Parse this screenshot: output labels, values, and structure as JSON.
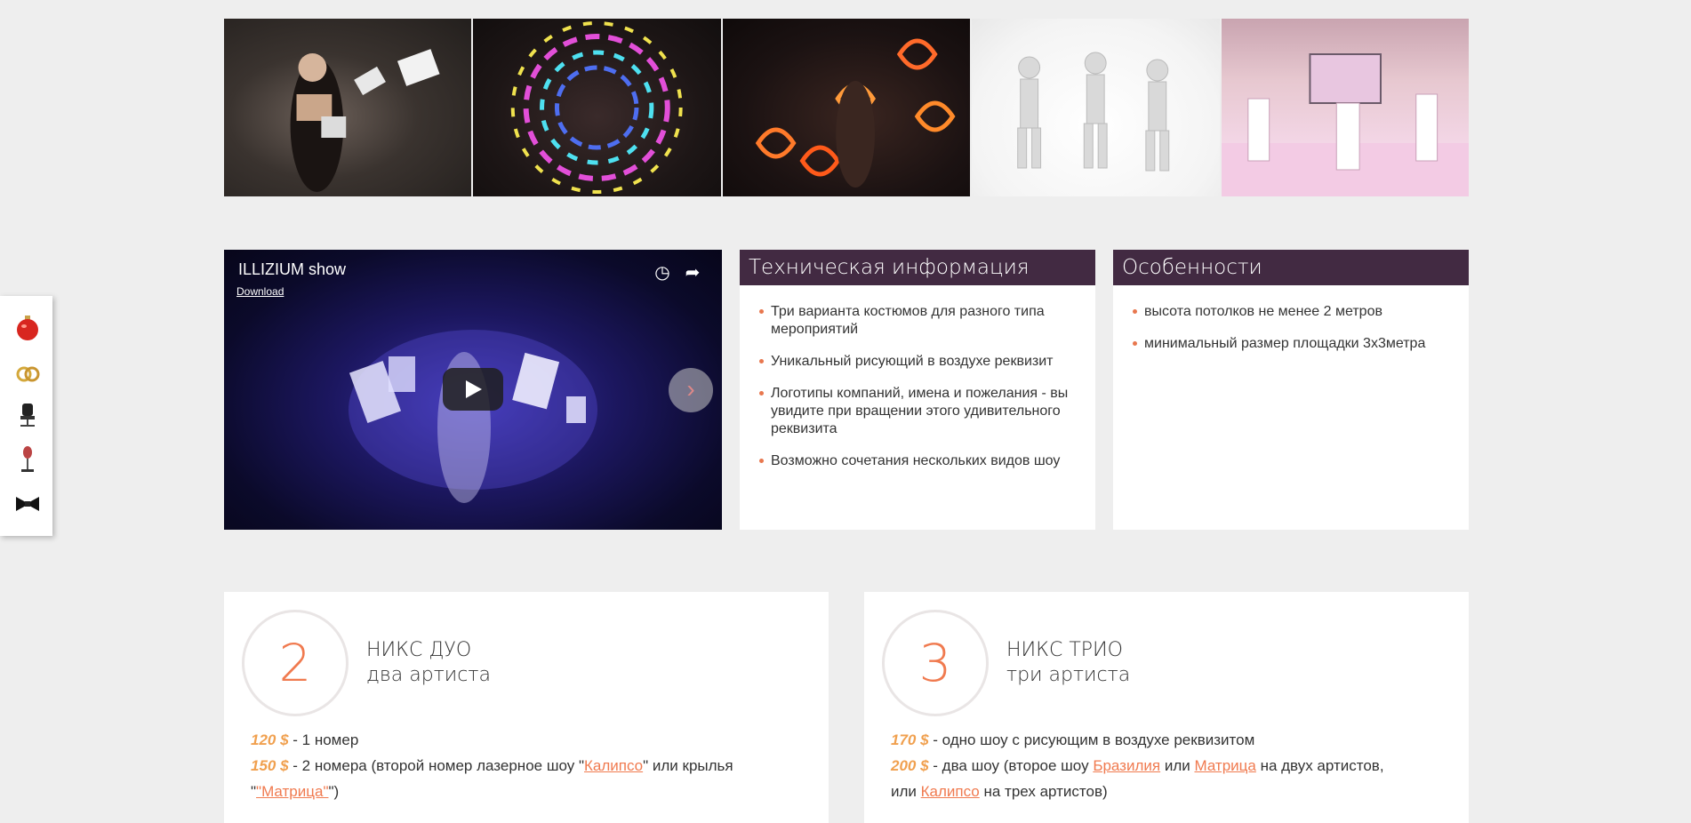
{
  "gallery": {
    "photos": [
      "photo-light-fans-performer",
      "photo-neon-pattern-circle",
      "photo-fire-poi-pattern",
      "photo-white-costume-trio",
      "photo-stage-show-hall"
    ]
  },
  "video": {
    "title": "ILLIZIUM show",
    "download": "Download",
    "icons": [
      "clock-icon",
      "share-icon",
      "play-icon",
      "next-arrow-icon"
    ]
  },
  "tech_panel": {
    "title": "Техническая информация",
    "items": [
      "Три варианта костюмов для разного типа мероприятий",
      "Уникальный рисующий в воздухе реквизит",
      "Логотипы компаний, имена и пожелания - вы увидите при вращении этого удивительного реквизита",
      "Возможно сочетания нескольких видов шоу"
    ]
  },
  "features_panel": {
    "title": "Особенности",
    "items": [
      "высота потолков не менее 2 метров",
      "минимальный размер площадки 3х3метра"
    ]
  },
  "sidebar": {
    "icons": [
      "christmas-ornament-icon",
      "wedding-rings-icon",
      "office-chair-icon",
      "microphone-icon",
      "bow-tie-icon"
    ]
  },
  "offers": [
    {
      "number": "2",
      "title": "НИКС ДУО",
      "subtitle": "два артиста",
      "line1": {
        "price": "120 $",
        "text": " - 1 номер"
      },
      "line2": {
        "price": "150 $",
        "text_a": " - 2 номера (второй номер лазерное шоу \"",
        "link_a": "Калипсо",
        "text_b": "\" или крылья \"",
        "link_b": "\"Матрица\"",
        "text_c": "\")"
      }
    },
    {
      "number": "3",
      "title": "НИКС ТРИО",
      "subtitle": "три артиста",
      "line1": {
        "price": "170 $",
        "text": " - одно шоу с рисующим в воздухе реквизитом"
      },
      "line2": {
        "price": "200 $",
        "text_a": " - два шоу (второе шоу ",
        "link_a": "Бразилия",
        "text_b": " или ",
        "link_b": "Матрица",
        "text_c": " на двух артистов,"
      },
      "line3": {
        "text_a": "или ",
        "link_a": "Калипсо",
        "text_b": " на трех артистов)"
      }
    }
  ],
  "colors": {
    "accent": "#f07a4f",
    "price": "#f0a04f",
    "panel_header": "#422a42",
    "page_bg": "#eeeeee"
  }
}
